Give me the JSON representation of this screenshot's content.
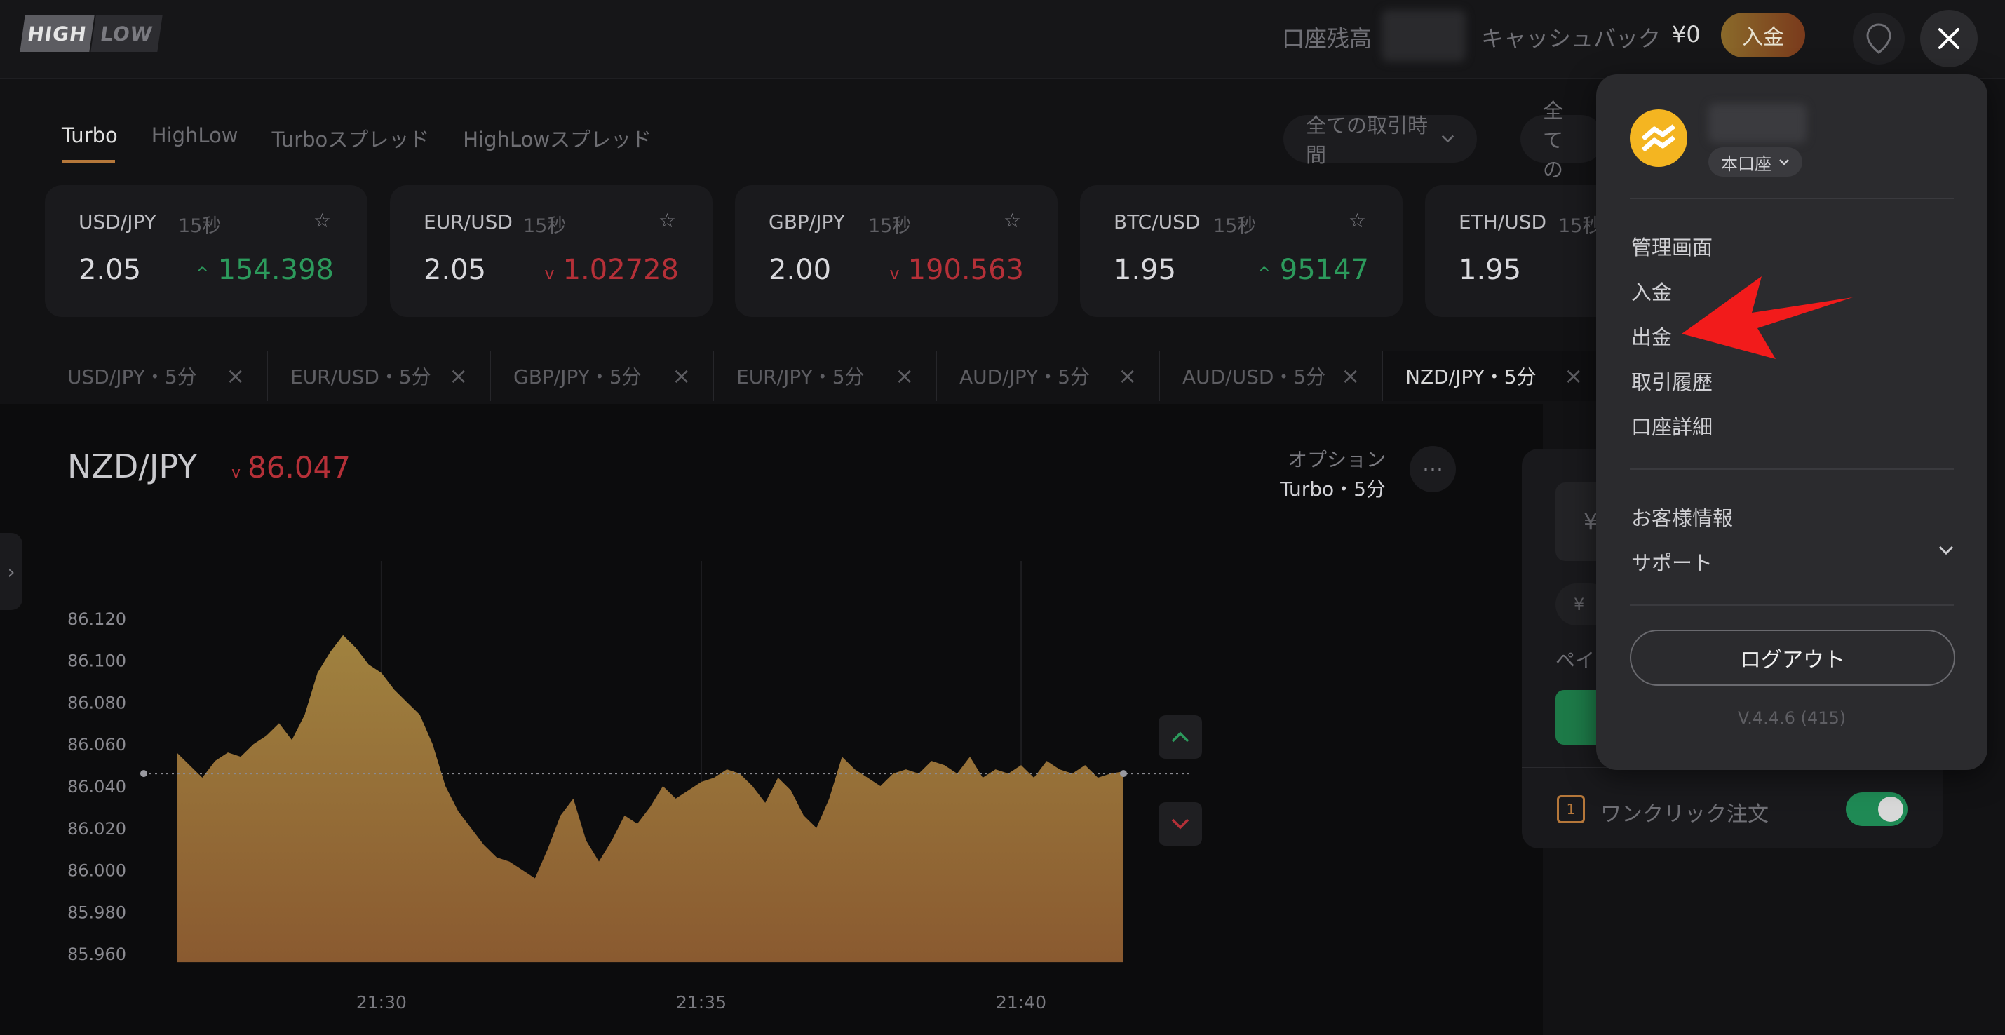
{
  "header": {
    "logo_high": "HIGH",
    "logo_low": "LOW",
    "account_balance_label": "口座残高",
    "cashback_label": "キャッシュバック",
    "cashback_value": "¥0",
    "deposit_button": "入金"
  },
  "tabs": [
    {
      "label": "Turbo",
      "active": true
    },
    {
      "label": "HighLow",
      "active": false
    },
    {
      "label": "Turboスプレッド",
      "active": false
    },
    {
      "label": "HighLowスプレッド",
      "active": false
    }
  ],
  "filters": {
    "trade_time": "全ての取引時間",
    "second_partial": "全ての"
  },
  "asset_cards": [
    {
      "pair": "USD/JPY",
      "duration": "15秒",
      "payout": "2.05",
      "price": "154.398",
      "direction": "up"
    },
    {
      "pair": "EUR/USD",
      "duration": "15秒",
      "payout": "2.05",
      "price": "1.02728",
      "direction": "down"
    },
    {
      "pair": "GBP/JPY",
      "duration": "15秒",
      "payout": "2.00",
      "price": "190.563",
      "direction": "down"
    },
    {
      "pair": "BTC/USD",
      "duration": "15秒",
      "payout": "1.95",
      "price": "95147",
      "direction": "up"
    },
    {
      "pair": "ETH/USD",
      "duration": "15秒",
      "payout": "1.95",
      "price": "",
      "direction": "up"
    }
  ],
  "chart_tabs": [
    {
      "label": "USD/JPY・5分",
      "active": false
    },
    {
      "label": "EUR/USD・5分",
      "active": false
    },
    {
      "label": "GBP/JPY・5分",
      "active": false
    },
    {
      "label": "EUR/JPY・5分",
      "active": false
    },
    {
      "label": "AUD/JPY・5分",
      "active": false
    },
    {
      "label": "AUD/USD・5分",
      "active": false
    },
    {
      "label": "NZD/JPY・5分",
      "active": true
    }
  ],
  "chart_header": {
    "pair": "NZD/JPY",
    "price": "86.047",
    "direction": "down",
    "option_label": "オプション",
    "option_value": "Turbo・5分"
  },
  "chart_data": {
    "type": "area",
    "y_ticks": [
      "86.120",
      "86.100",
      "86.080",
      "86.060",
      "86.040",
      "86.020",
      "86.000",
      "85.980",
      "85.960"
    ],
    "x_ticks": [
      "21:30",
      "21:35",
      "21:40"
    ],
    "ylim": [
      85.95,
      86.13
    ],
    "strike": 86.046,
    "x_minutes": [
      0,
      0.2,
      0.4,
      0.6,
      0.8,
      1.0,
      1.2,
      1.4,
      1.6,
      1.8,
      2.0,
      2.2,
      2.4,
      2.6,
      2.8,
      3.0,
      3.2,
      3.4,
      3.6,
      3.8,
      4.0,
      4.2,
      4.4,
      4.6,
      4.8,
      5.0,
      5.2,
      5.4,
      5.6,
      5.8,
      6.0,
      6.2,
      6.4,
      6.6,
      6.8,
      7.0,
      7.2,
      7.4,
      7.6,
      7.8,
      8.0,
      8.2,
      8.4,
      8.6,
      8.8,
      9.0,
      9.2,
      9.4,
      9.6,
      9.8,
      10.0,
      10.2,
      10.4,
      10.6,
      10.8,
      11.0,
      11.2,
      11.4,
      11.6,
      11.8,
      12.0,
      12.2,
      12.4,
      12.6,
      12.8,
      13.0,
      13.2,
      13.4,
      13.6,
      13.8,
      14.0,
      14.2,
      14.4,
      14.6,
      14.8
    ],
    "values": [
      86.056,
      86.05,
      86.044,
      86.052,
      86.056,
      86.054,
      86.06,
      86.064,
      86.07,
      86.062,
      86.074,
      86.094,
      86.104,
      86.112,
      86.106,
      86.098,
      86.094,
      86.086,
      86.08,
      86.074,
      86.06,
      86.04,
      86.028,
      86.02,
      86.012,
      86.006,
      86.004,
      86.0,
      85.996,
      86.01,
      86.026,
      86.034,
      86.014,
      86.004,
      86.014,
      86.026,
      86.022,
      86.03,
      86.04,
      86.034,
      86.038,
      86.042,
      86.044,
      86.048,
      86.046,
      86.04,
      86.032,
      86.044,
      86.038,
      86.026,
      86.02,
      86.034,
      86.054,
      86.048,
      86.044,
      86.04,
      86.046,
      86.048,
      86.046,
      86.052,
      86.05,
      86.046,
      86.054,
      86.044,
      86.048,
      86.046,
      86.05,
      86.044,
      86.052,
      86.048,
      86.046,
      86.05,
      86.044,
      86.046,
      86.047
    ],
    "x_tick_minutes": [
      3.2,
      8.2,
      13.2
    ],
    "fill_color_top": "#a0823f",
    "fill_color_bottom": "#8a5a30",
    "grid": false
  },
  "trade_panel": {
    "amount_prefix": "¥",
    "chip_prefix": "¥",
    "payout_partial": "ペイ",
    "one_click_label": "ワンクリック注文",
    "one_click_icon_text": "1",
    "one_click_on": true
  },
  "menu": {
    "account_type": "本口座",
    "items_group1": [
      "管理画面",
      "入金",
      "出金",
      "取引履歴",
      "口座詳細"
    ],
    "items_group2": [
      "お客様情報",
      "サポート"
    ],
    "logout": "ログアウト",
    "version": "V.4.4.6 (415)"
  },
  "colors": {
    "up": "#2c9a5c",
    "down": "#b53038",
    "accent": "#b5773a",
    "annotation_arrow": "#f21b1b"
  }
}
